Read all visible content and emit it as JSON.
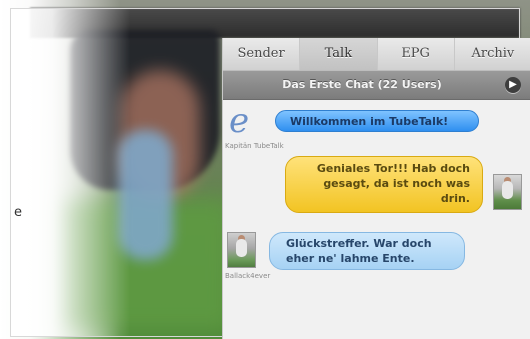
{
  "left_edge_text": "e",
  "tabs": [
    {
      "label": "Sender",
      "active": false
    },
    {
      "label": "Talk",
      "active": true
    },
    {
      "label": "EPG",
      "active": false
    },
    {
      "label": "Archiv",
      "active": false
    }
  ],
  "room": {
    "title": "Das Erste Chat (22 Users)",
    "arrow_icon": "chevron-right-circle-icon"
  },
  "messages": [
    {
      "sender": "Kapitän TubeTalk",
      "text": "Willkommen im TubeTalk!",
      "style": "blue",
      "side": "left",
      "avatar": "tubetalk-logo"
    },
    {
      "sender": "",
      "text": "Geniales Tor!!! Hab doch gesagt, da ist noch was drin.",
      "style": "yellow",
      "side": "right",
      "avatar": "user-photo"
    },
    {
      "sender": "Ballack4ever",
      "text": "Glückstreffer. War doch eher ne' lahme Ente.",
      "style": "lightblue",
      "side": "left",
      "avatar": "user-photo"
    }
  ],
  "colors": {
    "blue_bubble": "#2f8ff0",
    "yellow_bubble": "#f2c423",
    "lightblue_bubble": "#a6d2f4",
    "panel_bg": "#f1f1f1"
  }
}
